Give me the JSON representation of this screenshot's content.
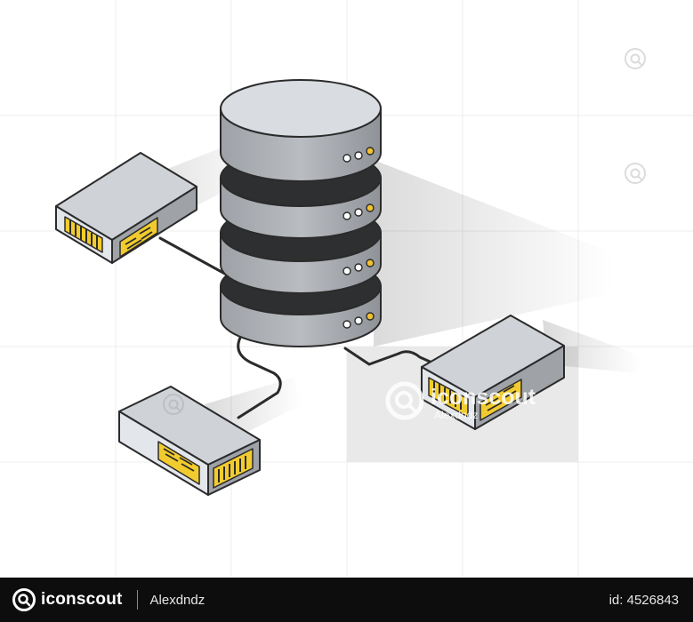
{
  "watermark": {
    "brand": "iconscout",
    "author": "Alexdndz",
    "wm_brand_color": "#ffffff",
    "panel_color": "#e9e9e9"
  },
  "footer": {
    "brand": "iconscout",
    "author": "Alexdndz",
    "asset_id": "id: 4526843",
    "bg_color": "#0d0d0d"
  },
  "colors": {
    "server_light": "#d9dde2",
    "server_mid": "#a9acb1",
    "server_dark": "#2e2f31",
    "device_top": "#cfd3d8",
    "device_left": "#e3e6ea",
    "device_right": "#9fa3a8",
    "display": "#f2cc2f",
    "led": "#f2c12e",
    "grid": "#ececec"
  },
  "icons": [
    "database-server-icon",
    "network-device-icon",
    "iconscout-logo-icon"
  ]
}
